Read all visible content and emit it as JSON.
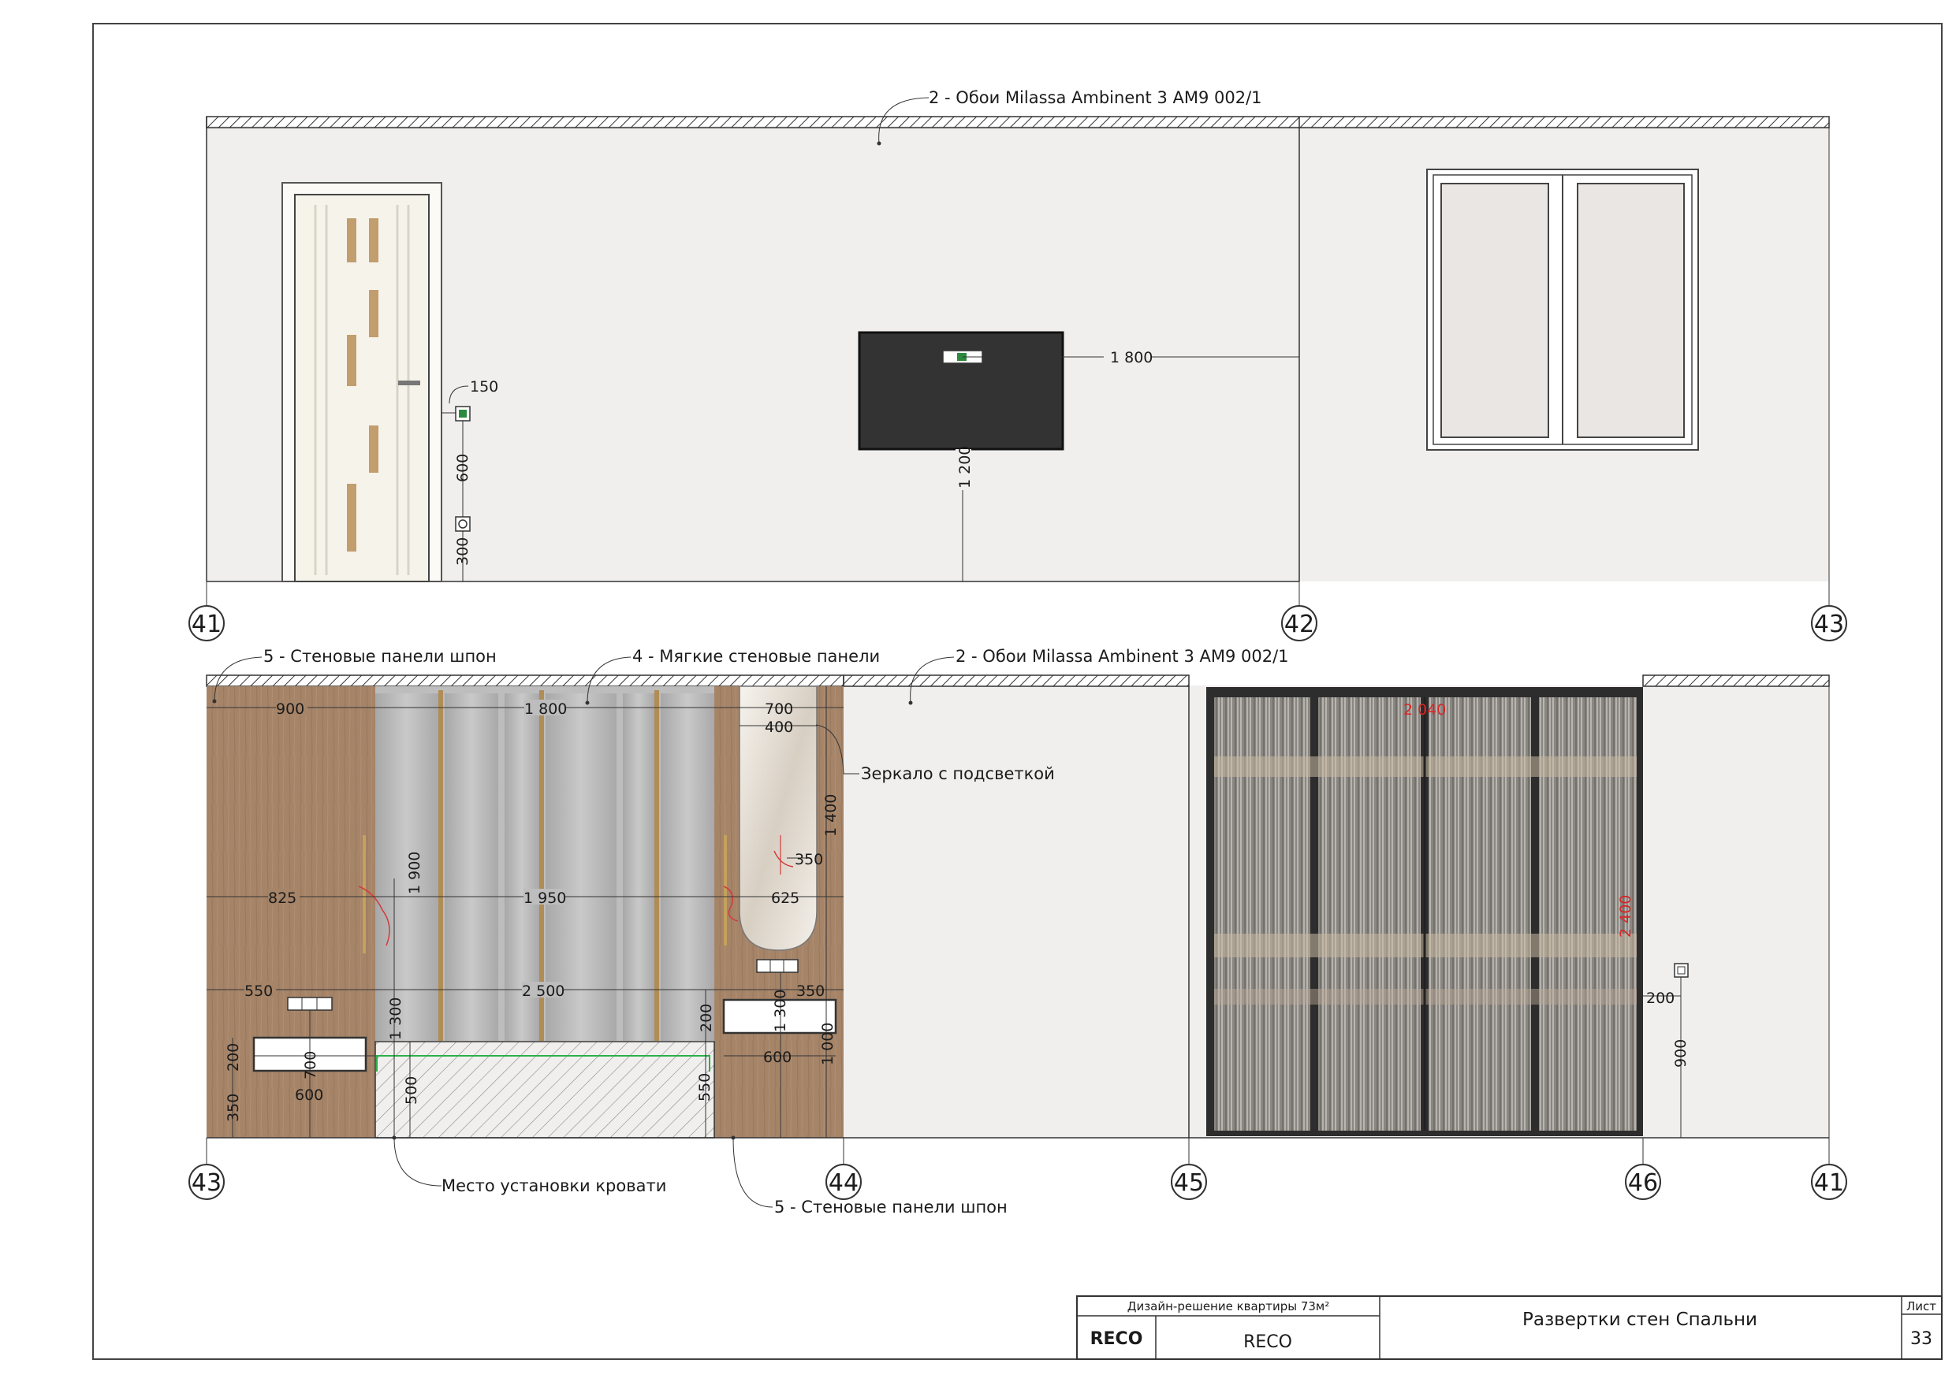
{
  "top_elevation": {
    "wallpaper_label": "2 - Обои Milassa Ambinent 3 AM9 002/1",
    "dims": {
      "socket_offset": "150",
      "switch_height": "600",
      "socket_height": "300",
      "tv_offset": "1 800",
      "tv_height": "1 200"
    },
    "axes": [
      "41",
      "42",
      "43"
    ]
  },
  "bottom_elevation": {
    "labels": {
      "veneer_panels_top": "5 - Стеновые панели шпон",
      "soft_panels": "4 - Мягкие стеновые панели",
      "wallpaper": "2 - Обои Milassa Ambinent 3 AM9 002/1",
      "mirror": "Зеркало с подсветкой",
      "bed_place": "Место установки кровати",
      "veneer_panels_bottom": "5 - Стеновые панели шпон"
    },
    "dims": {
      "d900": "900",
      "d1800": "1 800",
      "d700": "700",
      "d400": "400",
      "d1400": "1 400",
      "d1900": "1 900",
      "d350a": "350",
      "d825": "825",
      "d1950": "1 950",
      "d625": "625",
      "d550": "550",
      "d2500": "2 500",
      "d350b": "350",
      "d1300a": "1 300",
      "d1300b": "1 300",
      "d200a": "200",
      "d200b": "200",
      "d700b": "700",
      "d600a": "600",
      "d600b": "600",
      "d1000": "1 000",
      "d350c": "350",
      "d500": "500",
      "d550b": "550",
      "wardrobe_width": "2 040",
      "wardrobe_height": "2 400",
      "d200c": "200",
      "d900b": "900"
    },
    "axes": [
      "43",
      "44",
      "45",
      "46",
      "41"
    ]
  },
  "title_block": {
    "project": "Дизайн-решение квартиры 73м²",
    "company_logo_text": "RECO",
    "company": "RECO",
    "sheet_title": "Развертки стен Спальни",
    "sheet_label": "Лист",
    "sheet_number": "33"
  },
  "colors": {
    "wall": "#f1efee",
    "veneer": "#a68468",
    "soft_panel": "#b9b9b9",
    "tv": "#333333",
    "wardrobe_frame": "#222222",
    "red_dim": "#d62626",
    "logo_green": "#2b6e3c"
  }
}
